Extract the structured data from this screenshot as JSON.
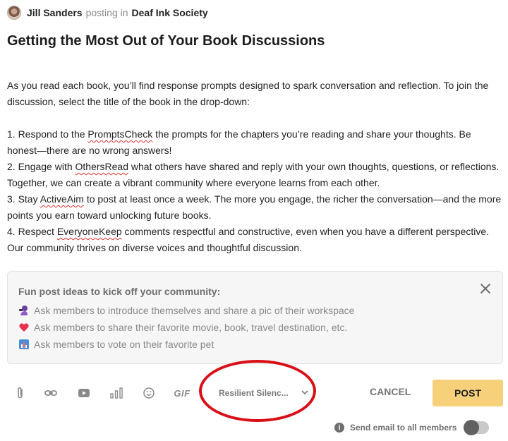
{
  "header": {
    "author": "Jill Sanders",
    "posting_in": "posting in",
    "group": "Deaf Ink Society"
  },
  "post": {
    "title": "Getting the Most Out of Your Book Discussions",
    "intro": "As you read each book, you’ll find response prompts designed to spark conversation and reflection. To join the discussion, select the title of the book in the drop-down:",
    "items": [
      {
        "prefix": "1. Respond to the ",
        "misspelled": "PromptsCheck",
        "rest": " the prompts for the chapters you’re reading and share your thoughts. Be honest—there are no wrong answers!"
      },
      {
        "prefix": "2. Engage with ",
        "misspelled": "OthersRead",
        "rest": " what others have shared and reply with your own thoughts, questions, or reflections. Together, we can create a vibrant community where everyone learns from each other."
      },
      {
        "prefix": "3. Stay ",
        "misspelled": "ActiveAim",
        "rest": " to post at least once a week. The more you engage, the richer the conversation—and the more points you earn toward unlocking future books."
      },
      {
        "prefix": "4. Respect ",
        "misspelled": "EveryoneKeep",
        "rest": " comments respectful and constructive, even when you have a different perspective. Our community thrives on diverse voices and thoughtful discussion."
      }
    ]
  },
  "ideas": {
    "title": "Fun post ideas to kick off your community:",
    "items": [
      {
        "icon": "painter-icon",
        "text": "Ask members to introduce themselves and share a pic of their workspace"
      },
      {
        "icon": "heart-icon",
        "text": "Ask members to share their favorite movie, book, travel destination, etc."
      },
      {
        "icon": "bar-chart-icon",
        "text": "Ask members to vote on their favorite pet"
      }
    ]
  },
  "toolbar": {
    "gif_label": "GIF",
    "selected_book": "Resilient Silenc...",
    "cancel_label": "CANCEL",
    "post_label": "POST"
  },
  "email": {
    "label": "Send email to all members",
    "enabled": false
  },
  "colors": {
    "accent": "#f7d07a",
    "annotation": "#d90f17"
  }
}
